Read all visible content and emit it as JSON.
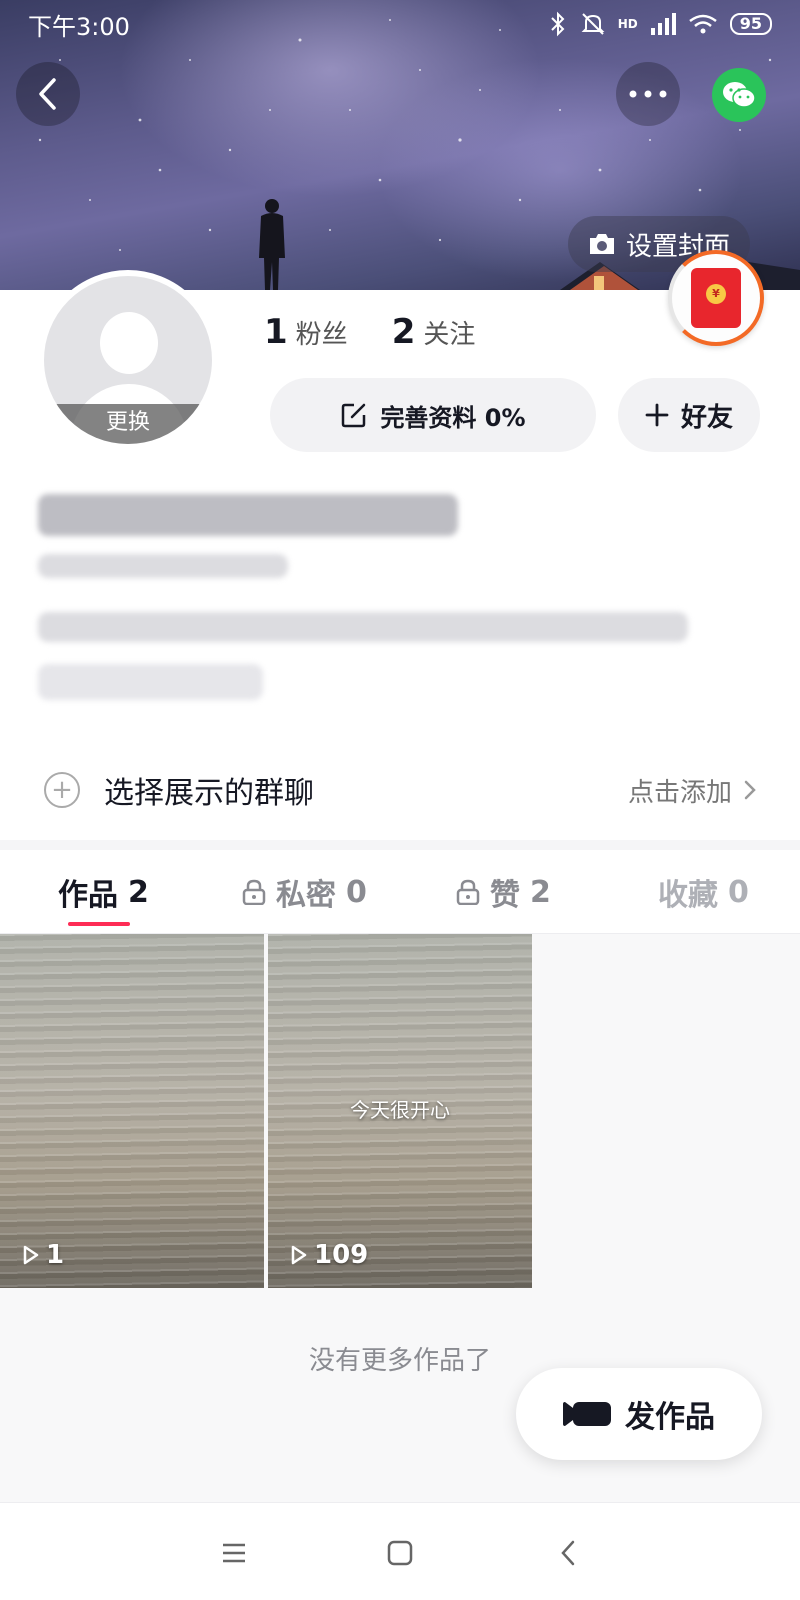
{
  "status_bar": {
    "time": "下午3:00",
    "network": "HD",
    "battery": "95",
    "icons": [
      "bluetooth-icon",
      "mute-icon",
      "signal-icon",
      "wifi-icon",
      "battery-icon"
    ]
  },
  "header": {
    "back_icon": "back-icon",
    "more_icon": "more-icon",
    "share_icon": "wechat-icon",
    "set_cover_label": "设置封面"
  },
  "profile": {
    "avatar_change_label": "更换",
    "followers_count": "1",
    "followers_label": "粉丝",
    "following_count": "2",
    "following_label": "关注",
    "edit_profile_label": "完善资料 0%",
    "add_friend_label": "好友"
  },
  "group_chat": {
    "label": "选择展示的群聊",
    "action": "点击添加"
  },
  "tabs": [
    {
      "label": "作品",
      "count": "2",
      "locked": false,
      "active": true
    },
    {
      "label": "私密",
      "count": "0",
      "locked": true,
      "active": false
    },
    {
      "label": "赞",
      "count": "2",
      "locked": true,
      "active": false
    },
    {
      "label": "收藏",
      "count": "0",
      "locked": false,
      "active": false
    }
  ],
  "videos": [
    {
      "caption": "",
      "plays": "1"
    },
    {
      "caption": "今天很开心",
      "plays": "109"
    }
  ],
  "end_note": "没有更多作品了",
  "post_button_label": "发作品",
  "colors": {
    "accent": "#fe2c55",
    "wechat": "#2ac45a",
    "redpacket": "#e8262d"
  }
}
